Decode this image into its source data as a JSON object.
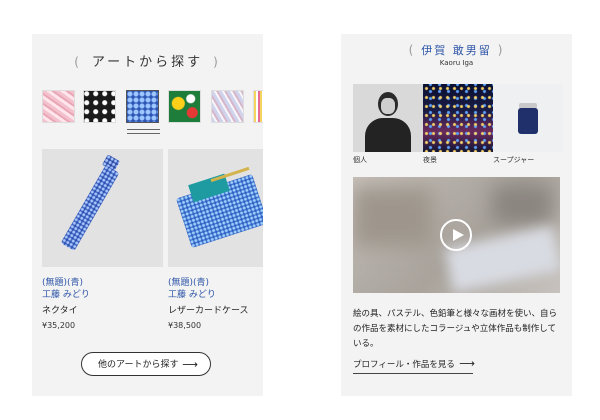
{
  "left": {
    "title": "アートから探す",
    "paren_open": "(",
    "paren_close": ")",
    "products": [
      {
        "subtitle": "(無題)(青)",
        "artist": "工藤 みどり",
        "name": "ネクタイ",
        "price": "¥35,200"
      },
      {
        "subtitle": "(無題)(青)",
        "artist": "工藤 みどり",
        "name": "レザーカードケース",
        "price": "¥38,500"
      }
    ],
    "more_button": "他のアートから探す",
    "arrow": "⟶"
  },
  "right": {
    "artist_name": "伊賀 敢男留",
    "artist_roman": "Kaoru Iga",
    "paren_open": "(",
    "paren_close": ")",
    "gallery": [
      {
        "label": "個人"
      },
      {
        "label": "夜景"
      },
      {
        "label": "スープジャー"
      }
    ],
    "bio": "絵の具、パステル、色鉛筆と様々な画材を使い、自らの作品を素材にしたコラージュや立体作品も制作している。",
    "profile_link": "プロフィール・作品を見る",
    "arrow": "⟶"
  },
  "colors": {
    "accent": "#2f56a8",
    "card_bg": "#f3f3f3"
  }
}
